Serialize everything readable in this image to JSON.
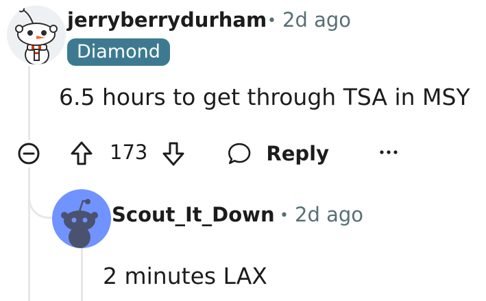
{
  "comment": {
    "username": "jerryberrydurham",
    "separator": "•",
    "time": "2d ago",
    "flair": "Diamond",
    "body": "6.5 hours to get through TSA in MSY",
    "actions": {
      "votes": "173",
      "reply_label": "Reply",
      "more_label": "···"
    }
  },
  "reply": {
    "username": "Scout_It_Down",
    "separator": "•",
    "time": "2d ago",
    "body": "2 minutes LAX"
  },
  "icons": {
    "collapse": "minus-circle-icon",
    "upvote": "arrow-up-icon",
    "downvote": "arrow-down-icon",
    "reply": "speech-bubble-icon",
    "more": "ellipsis-icon"
  },
  "colors": {
    "flair_bg": "#3d7a91",
    "meta": "#576f76",
    "reply_avatar_bg": "#7193ff",
    "thread_line": "#e5e7ea"
  }
}
